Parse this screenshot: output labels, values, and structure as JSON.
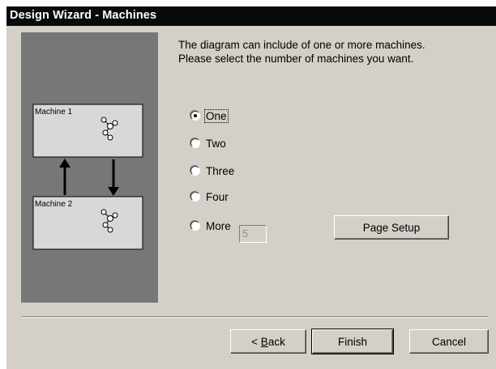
{
  "window": {
    "title": "Design Wizard - Machines"
  },
  "preview": {
    "machine1_label": "Machine 1",
    "machine2_label": "Machine 2"
  },
  "intro": {
    "line1": "The diagram can include of one or more machines.",
    "line2": "Please select the number of machines you want."
  },
  "options": [
    {
      "label": "One",
      "checked": true
    },
    {
      "label": "Two",
      "checked": false
    },
    {
      "label": "Three",
      "checked": false
    },
    {
      "label": "Four",
      "checked": false
    },
    {
      "label": "More",
      "checked": false
    }
  ],
  "more_value": "5",
  "buttons": {
    "page_setup": "Page Setup",
    "back_prefix": "< ",
    "back_accel": "B",
    "back_rest": "ack",
    "finish": "Finish",
    "cancel": "Cancel"
  },
  "icons": [
    "arrow-up-icon",
    "arrow-down-icon",
    "machine-graph-icon"
  ]
}
